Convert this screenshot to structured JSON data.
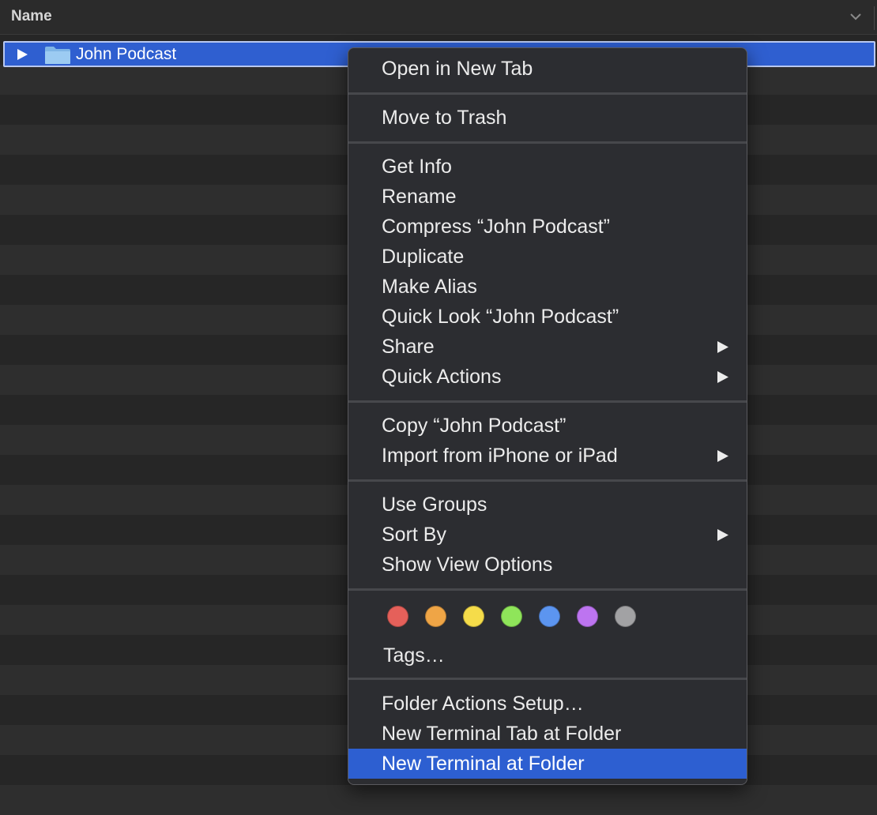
{
  "header": {
    "column_name": "Name"
  },
  "file_row": {
    "name": "John Podcast"
  },
  "menu": {
    "open_new_tab": "Open in New Tab",
    "move_to_trash": "Move to Trash",
    "get_info": "Get Info",
    "rename": "Rename",
    "compress": "Compress “John Podcast”",
    "duplicate": "Duplicate",
    "make_alias": "Make Alias",
    "quick_look": "Quick Look “John Podcast”",
    "share": "Share",
    "quick_actions": "Quick Actions",
    "copy": "Copy “John Podcast”",
    "import_iphone": "Import from iPhone or iPad",
    "use_groups": "Use Groups",
    "sort_by": "Sort By",
    "show_view_options": "Show View Options",
    "tags": "Tags…",
    "folder_actions_setup": "Folder Actions Setup…",
    "new_terminal_tab": "New Terminal Tab at Folder",
    "new_terminal": "New Terminal at Folder"
  },
  "tag_colors": {
    "red": "#e5605a",
    "orange": "#efa546",
    "yellow": "#f5dc4a",
    "green": "#8fe55a",
    "blue": "#5c95f0",
    "purple": "#bd74f0",
    "gray": "#a2a2a4"
  },
  "highlight_color": "#2d5fd1",
  "icons": {
    "disclosure": "disclosure-triangle-icon",
    "folder": "folder-icon",
    "submenu": "submenu-arrow-icon",
    "sort": "chevron-down-icon"
  }
}
